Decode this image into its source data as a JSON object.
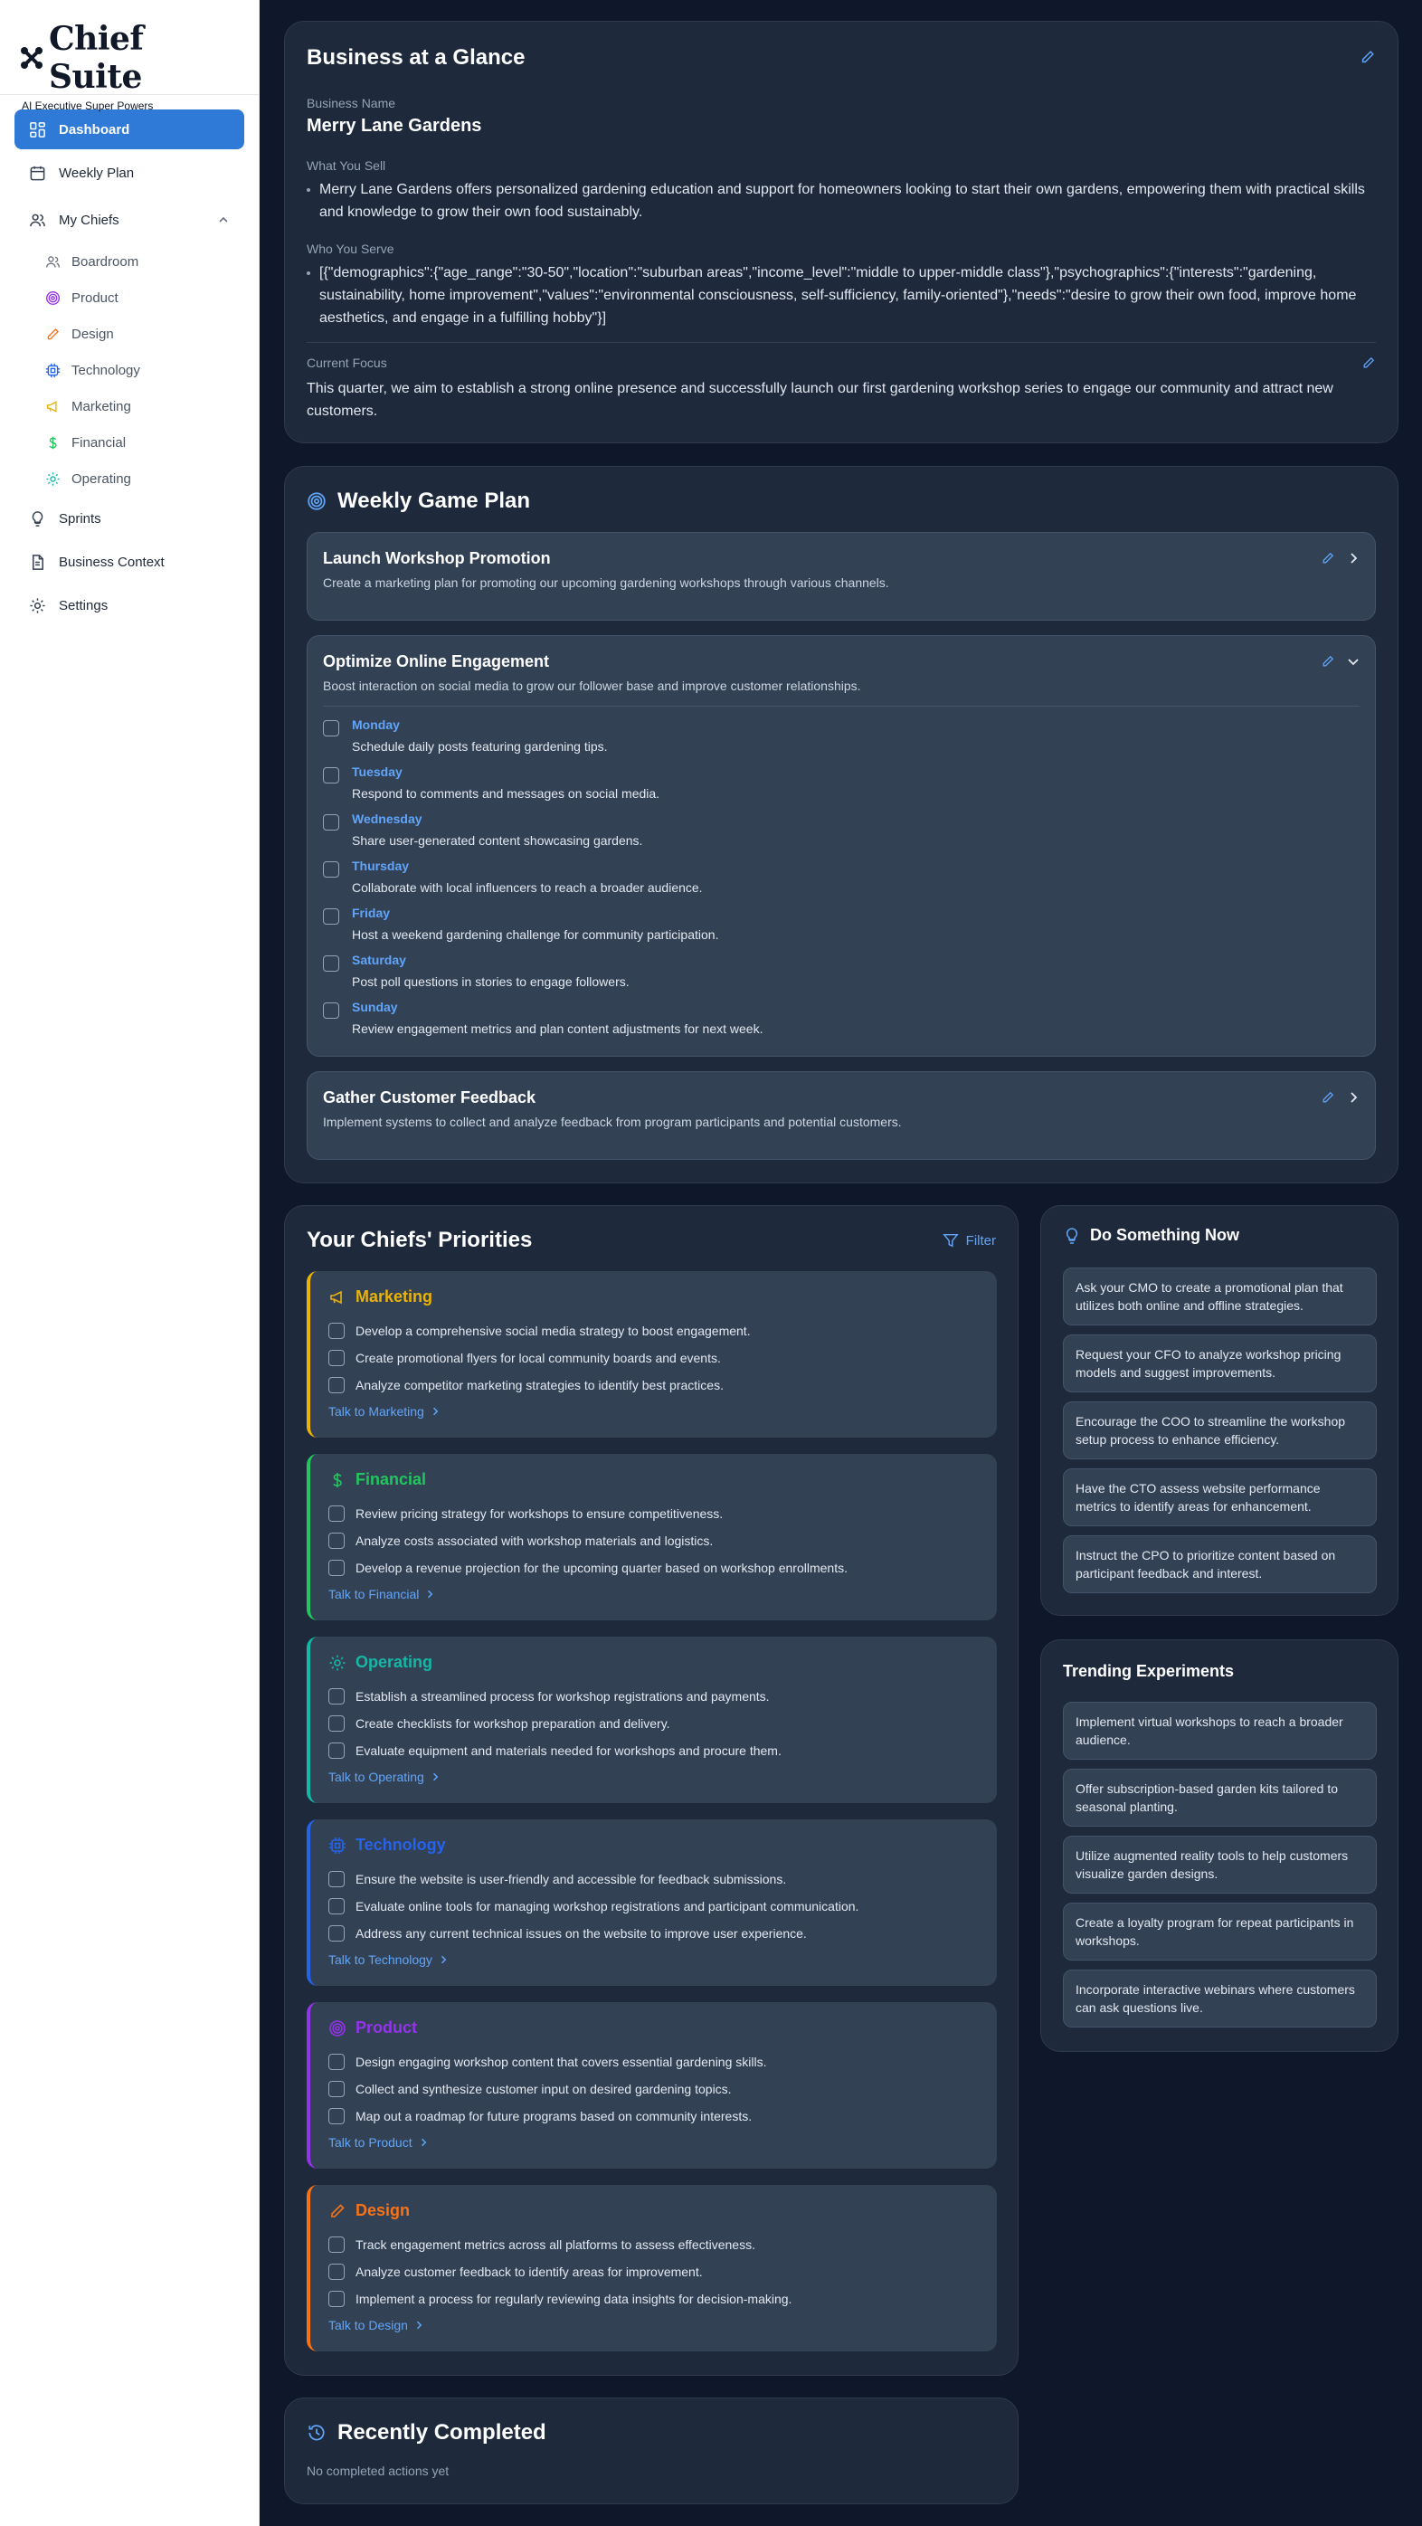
{
  "app": {
    "logo_text": "Chief Suite",
    "tagline": "AI Executive Super Powers"
  },
  "nav": {
    "dashboard": "Dashboard",
    "weekly_plan": "Weekly Plan",
    "my_chiefs": "My Chiefs",
    "chiefs": [
      "Boardroom",
      "Product",
      "Design",
      "Technology",
      "Marketing",
      "Financial",
      "Operating"
    ],
    "sprints": "Sprints",
    "business_context": "Business Context",
    "settings": "Settings"
  },
  "glance": {
    "title": "Business at a Glance",
    "business_name_label": "Business Name",
    "business_name": "Merry Lane Gardens",
    "what_you_sell_label": "What You Sell",
    "what_you_sell": "Merry Lane Gardens offers personalized gardening education and support for homeowners looking to start their own gardens, empowering them with practical skills and knowledge to grow their own food sustainably.",
    "who_you_serve_label": "Who You Serve",
    "who_you_serve": "[{\"demographics\":{\"age_range\":\"30-50\",\"location\":\"suburban areas\",\"income_level\":\"middle to upper-middle class\"},\"psychographics\":{\"interests\":\"gardening, sustainability, home improvement\",\"values\":\"environmental consciousness, self-sufficiency, family-oriented\"},\"needs\":\"desire to grow their own food, improve home aesthetics, and engage in a fulfilling hobby\"}]",
    "current_focus_label": "Current Focus",
    "current_focus": "This quarter, we aim to establish a strong online presence and successfully launch our first gardening workshop series to engage our community and attract new customers."
  },
  "weekly": {
    "title": "Weekly Game Plan",
    "goals": [
      {
        "title": "Launch Workshop Promotion",
        "desc": "Create a marketing plan for promoting our upcoming gardening workshops through various channels."
      },
      {
        "title": "Optimize Online Engagement",
        "desc": "Boost interaction on social media to grow our follower base and improve customer relationships."
      },
      {
        "title": "Gather Customer Feedback",
        "desc": "Implement systems to collect and analyze feedback from program participants and potential customers."
      }
    ],
    "days": [
      {
        "day": "Monday",
        "task": "Schedule daily posts featuring gardening tips."
      },
      {
        "day": "Tuesday",
        "task": "Respond to comments and messages on social media."
      },
      {
        "day": "Wednesday",
        "task": "Share user-generated content showcasing gardens."
      },
      {
        "day": "Thursday",
        "task": "Collaborate with local influencers to reach a broader audience."
      },
      {
        "day": "Friday",
        "task": "Host a weekend gardening challenge for community participation."
      },
      {
        "day": "Saturday",
        "task": "Post poll questions in stories to engage followers."
      },
      {
        "day": "Sunday",
        "task": "Review engagement metrics and plan content adjustments for next week."
      }
    ]
  },
  "priorities": {
    "title": "Your Chiefs' Priorities",
    "filter": "Filter",
    "chiefs": [
      {
        "name": "Marketing",
        "color": "#eab308",
        "talk": "Talk to Marketing",
        "tasks": [
          "Develop a comprehensive social media strategy to boost engagement.",
          "Create promotional flyers for local community boards and events.",
          "Analyze competitor marketing strategies to identify best practices."
        ]
      },
      {
        "name": "Financial",
        "color": "#22c55e",
        "talk": "Talk to Financial",
        "tasks": [
          "Review pricing strategy for workshops to ensure competitiveness.",
          "Analyze costs associated with workshop materials and logistics.",
          "Develop a revenue projection for the upcoming quarter based on workshop enrollments."
        ]
      },
      {
        "name": "Operating",
        "color": "#14b8a6",
        "talk": "Talk to Operating",
        "tasks": [
          "Establish a streamlined process for workshop registrations and payments.",
          "Create checklists for workshop preparation and delivery.",
          "Evaluate equipment and materials needed for workshops and procure them."
        ]
      },
      {
        "name": "Technology",
        "color": "#2563eb",
        "talk": "Talk to Technology",
        "tasks": [
          "Ensure the website is user-friendly and accessible for feedback submissions.",
          "Evaluate online tools for managing workshop registrations and participant communication.",
          "Address any current technical issues on the website to improve user experience."
        ]
      },
      {
        "name": "Product",
        "color": "#9333ea",
        "talk": "Talk to Product",
        "tasks": [
          "Design engaging workshop content that covers essential gardening skills.",
          "Collect and synthesize customer input on desired gardening topics.",
          "Map out a roadmap for future programs based on community interests."
        ]
      },
      {
        "name": "Design",
        "color": "#f97316",
        "talk": "Talk to Design",
        "tasks": [
          "Track engagement metrics across all platforms to assess effectiveness.",
          "Analyze customer feedback to identify areas for improvement.",
          "Implement a process for regularly reviewing data insights for decision-making."
        ]
      }
    ]
  },
  "do_now": {
    "title": "Do Something Now",
    "items": [
      "Ask your CMO to create a promotional plan that utilizes both online and offline strategies.",
      "Request your CFO to analyze workshop pricing models and suggest improvements.",
      "Encourage the COO to streamline the workshop setup process to enhance efficiency.",
      "Have the CTO assess website performance metrics to identify areas for enhancement.",
      "Instruct the CPO to prioritize content based on participant feedback and interest."
    ]
  },
  "trending": {
    "title": "Trending Experiments",
    "items": [
      "Implement virtual workshops to reach a broader audience.",
      "Offer subscription-based garden kits tailored to seasonal planting.",
      "Utilize augmented reality tools to help customers visualize garden designs.",
      "Create a loyalty program for repeat participants in workshops.",
      "Incorporate interactive webinars where customers can ask questions live."
    ]
  },
  "recent": {
    "title": "Recently Completed",
    "empty": "No completed actions yet"
  }
}
